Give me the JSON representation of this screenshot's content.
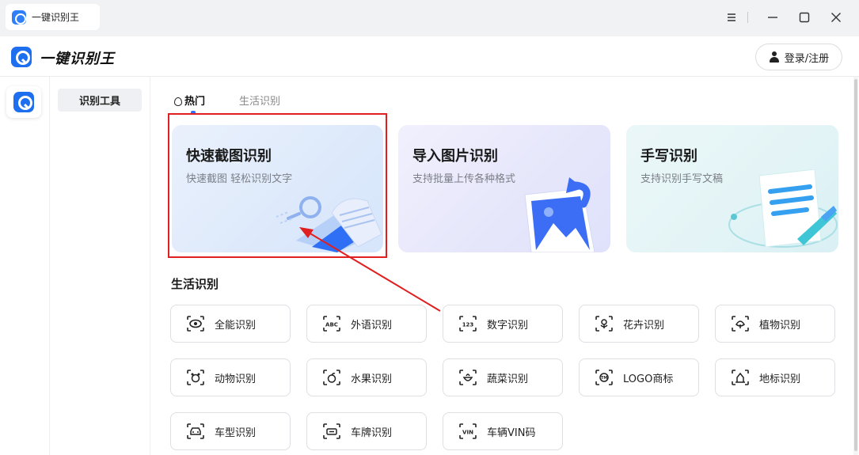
{
  "window": {
    "tab_title": "一键识别王"
  },
  "header": {
    "app_name": "一键识别王",
    "login_label": "登录/注册"
  },
  "subnav": {
    "items": [
      {
        "label": "识别工具"
      }
    ]
  },
  "tabs": [
    {
      "label": "热门"
    },
    {
      "label": "生活识别"
    }
  ],
  "cards": [
    {
      "title": "快速截图识别",
      "subtitle": "快速截图 轻松识别文字"
    },
    {
      "title": "导入图片识别",
      "subtitle": "支持批量上传各种格式"
    },
    {
      "title": "手写识别",
      "subtitle": "支持识别手写文稿"
    }
  ],
  "section": {
    "title": "生活识别",
    "tools": [
      {
        "label": "全能识别",
        "icon": "eye-scan-icon"
      },
      {
        "label": "外语识别",
        "icon": "abc-scan-icon"
      },
      {
        "label": "数字识别",
        "icon": "123-scan-icon"
      },
      {
        "label": "花卉识别",
        "icon": "flower-scan-icon"
      },
      {
        "label": "植物识别",
        "icon": "plant-scan-icon"
      },
      {
        "label": "动物识别",
        "icon": "animal-scan-icon"
      },
      {
        "label": "水果识别",
        "icon": "fruit-scan-icon"
      },
      {
        "label": "蔬菜识别",
        "icon": "vegetable-scan-icon"
      },
      {
        "label": "LOGO商标",
        "icon": "tm-scan-icon"
      },
      {
        "label": "地标识别",
        "icon": "landmark-scan-icon"
      },
      {
        "label": "车型识别",
        "icon": "car-scan-icon"
      },
      {
        "label": "车牌识别",
        "icon": "plate-scan-icon"
      },
      {
        "label": "车辆VIN码",
        "icon": "vin-scan-icon"
      }
    ]
  },
  "colors": {
    "accent": "#2f6fff",
    "annotation": "#e02020"
  }
}
